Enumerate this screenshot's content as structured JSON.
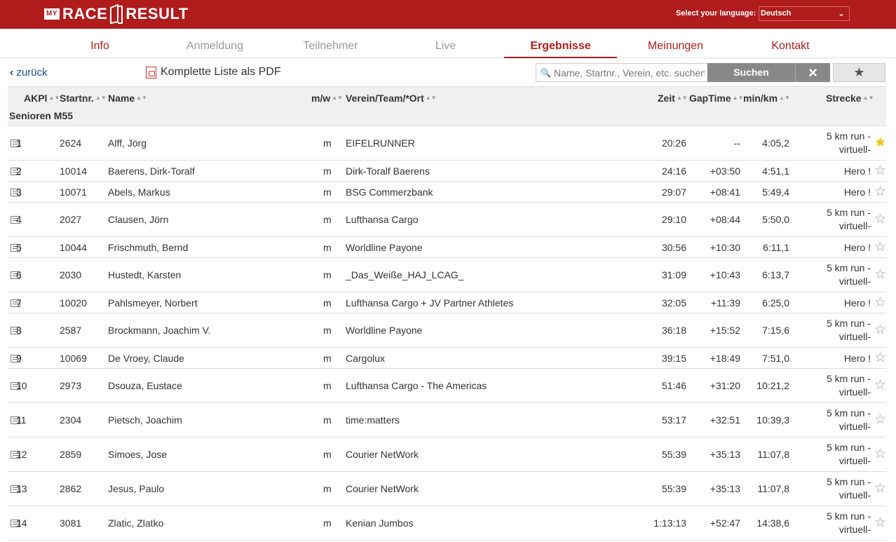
{
  "header": {
    "logo_my": "MY",
    "logo_race": "RACE",
    "logo_result": "RESULT",
    "lang_label": "Select your language:",
    "lang_value": "Deutsch"
  },
  "nav": {
    "tabs": [
      "Info",
      "Anmeldung",
      "Teilnehmer",
      "Live",
      "Ergebnisse",
      "Meinungen",
      "Kontakt"
    ],
    "active": "Ergebnisse"
  },
  "toolbar": {
    "back_label": "zurück",
    "pdf_label": "Komplette Liste als PDF",
    "search_placeholder": "Name, Startnr., Verein, etc. suchen",
    "search_button": "Suchen",
    "clear_icon": "×",
    "fav_icon": "★"
  },
  "table": {
    "headers": {
      "akpl": "AKPl",
      "startnr": "Startnr.",
      "name": "Name",
      "mw": "m/w",
      "verein": "Verein/Team/*Ort",
      "zeit": "Zeit",
      "gap": "GapTime",
      "minkm": "min/km",
      "strecke": "Strecke"
    },
    "group": "Senioren M55",
    "rows": [
      {
        "pl": "1",
        "nr": "2624",
        "name": "Alff, Jörg",
        "mw": "m",
        "verein": "EIFELRUNNER",
        "zeit": "20:26",
        "gap": "--",
        "pace": "4:05,2",
        "strecke": "5 km run - virtuell-",
        "fav": true
      },
      {
        "pl": "2",
        "nr": "10014",
        "name": "Baerens, Dirk-Toralf",
        "mw": "m",
        "verein": "Dirk-Toralf Baerens",
        "zeit": "24:16",
        "gap": "+03:50",
        "pace": "4:51,1",
        "strecke": "Hero !",
        "fav": false
      },
      {
        "pl": "3",
        "nr": "10071",
        "name": "Abels, Markus",
        "mw": "m",
        "verein": "BSG Commerzbank",
        "zeit": "29:07",
        "gap": "+08:41",
        "pace": "5:49,4",
        "strecke": "Hero !",
        "fav": false
      },
      {
        "pl": "4",
        "nr": "2027",
        "name": "Clausen, Jörn",
        "mw": "m",
        "verein": "Lufthansa Cargo",
        "zeit": "29:10",
        "gap": "+08:44",
        "pace": "5:50,0",
        "strecke": "5 km run - virtuell-",
        "fav": false
      },
      {
        "pl": "5",
        "nr": "10044",
        "name": "Frischmuth, Bernd",
        "mw": "m",
        "verein": "Worldline Payone",
        "zeit": "30:56",
        "gap": "+10:30",
        "pace": "6:11,1",
        "strecke": "Hero !",
        "fav": false
      },
      {
        "pl": "6",
        "nr": "2030",
        "name": "Hustedt, Karsten",
        "mw": "m",
        "verein": "_Das_Weiße_HAJ_LCAG_",
        "zeit": "31:09",
        "gap": "+10:43",
        "pace": "6:13,7",
        "strecke": "5 km run - virtuell-",
        "fav": false
      },
      {
        "pl": "7",
        "nr": "10020",
        "name": "Pahlsmeyer, Norbert",
        "mw": "m",
        "verein": "Lufthansa Cargo + JV Partner Athletes",
        "zeit": "32:05",
        "gap": "+11:39",
        "pace": "6:25,0",
        "strecke": "Hero !",
        "fav": false
      },
      {
        "pl": "8",
        "nr": "2587",
        "name": "Brockmann, Joachim V.",
        "mw": "m",
        "verein": "Worldline Payone",
        "zeit": "36:18",
        "gap": "+15:52",
        "pace": "7:15,6",
        "strecke": "5 km run - virtuell-",
        "fav": false
      },
      {
        "pl": "9",
        "nr": "10069",
        "name": "De Vroey, Claude",
        "mw": "m",
        "verein": "Cargolux",
        "zeit": "39:15",
        "gap": "+18:49",
        "pace": "7:51,0",
        "strecke": "Hero !",
        "fav": false
      },
      {
        "pl": "10",
        "nr": "2973",
        "name": "Dsouza, Eustace",
        "mw": "m",
        "verein": "Lufthansa Cargo - The Americas",
        "zeit": "51:46",
        "gap": "+31:20",
        "pace": "10:21,2",
        "strecke": "5 km run - virtuell-",
        "fav": false
      },
      {
        "pl": "11",
        "nr": "2304",
        "name": "Pietsch, Joachim",
        "mw": "m",
        "verein": "time:matters",
        "zeit": "53:17",
        "gap": "+32:51",
        "pace": "10:39,3",
        "strecke": "5 km run - virtuell-",
        "fav": false
      },
      {
        "pl": "12",
        "nr": "2859",
        "name": "Simoes, Jose",
        "mw": "m",
        "verein": "Courier NetWork",
        "zeit": "55:39",
        "gap": "+35:13",
        "pace": "11:07,8",
        "strecke": "5 km run - virtuell-",
        "fav": false
      },
      {
        "pl": "13",
        "nr": "2862",
        "name": "Jesus, Paulo",
        "mw": "m",
        "verein": "Courier NetWork",
        "zeit": "55:39",
        "gap": "+35:13",
        "pace": "11:07,8",
        "strecke": "5 km run - virtuell-",
        "fav": false
      },
      {
        "pl": "14",
        "nr": "3081",
        "name": "Zlatic, Zlatko",
        "mw": "m",
        "verein": "Kenian Jumbos",
        "zeit": "1:13:13",
        "gap": "+52:47",
        "pace": "14:38,6",
        "strecke": "5 km run - virtuell-",
        "fav": false
      }
    ]
  },
  "colors": {
    "brand_red": "#b01c1c",
    "link_blue": "#1d4f8f",
    "star_gold": "#f2c200"
  }
}
